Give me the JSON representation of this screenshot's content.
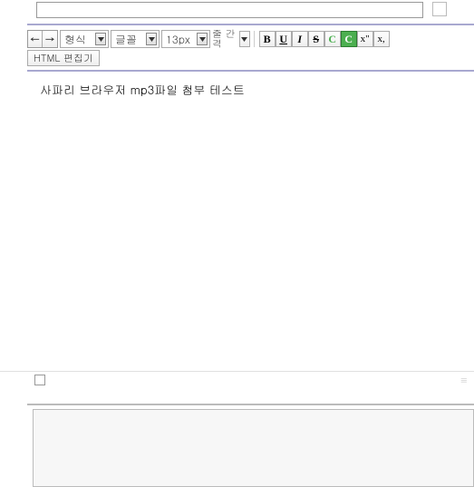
{
  "top": {
    "input_value": ""
  },
  "toolbar": {
    "back": "←",
    "forward": "→",
    "format_select": "형식",
    "font_select": "글꼴",
    "size_select": "13px",
    "linespacing_label": "줄 간\n격",
    "bold": "B",
    "underline": "U",
    "italic": "I",
    "strike": "S",
    "color1": "C",
    "color2": "C",
    "superscript": "x\"",
    "subscript": "x,",
    "html_edit": "HTML 편집기"
  },
  "editor": {
    "content": "사파리 브라우저 mp3파일 첨부 테스트"
  }
}
